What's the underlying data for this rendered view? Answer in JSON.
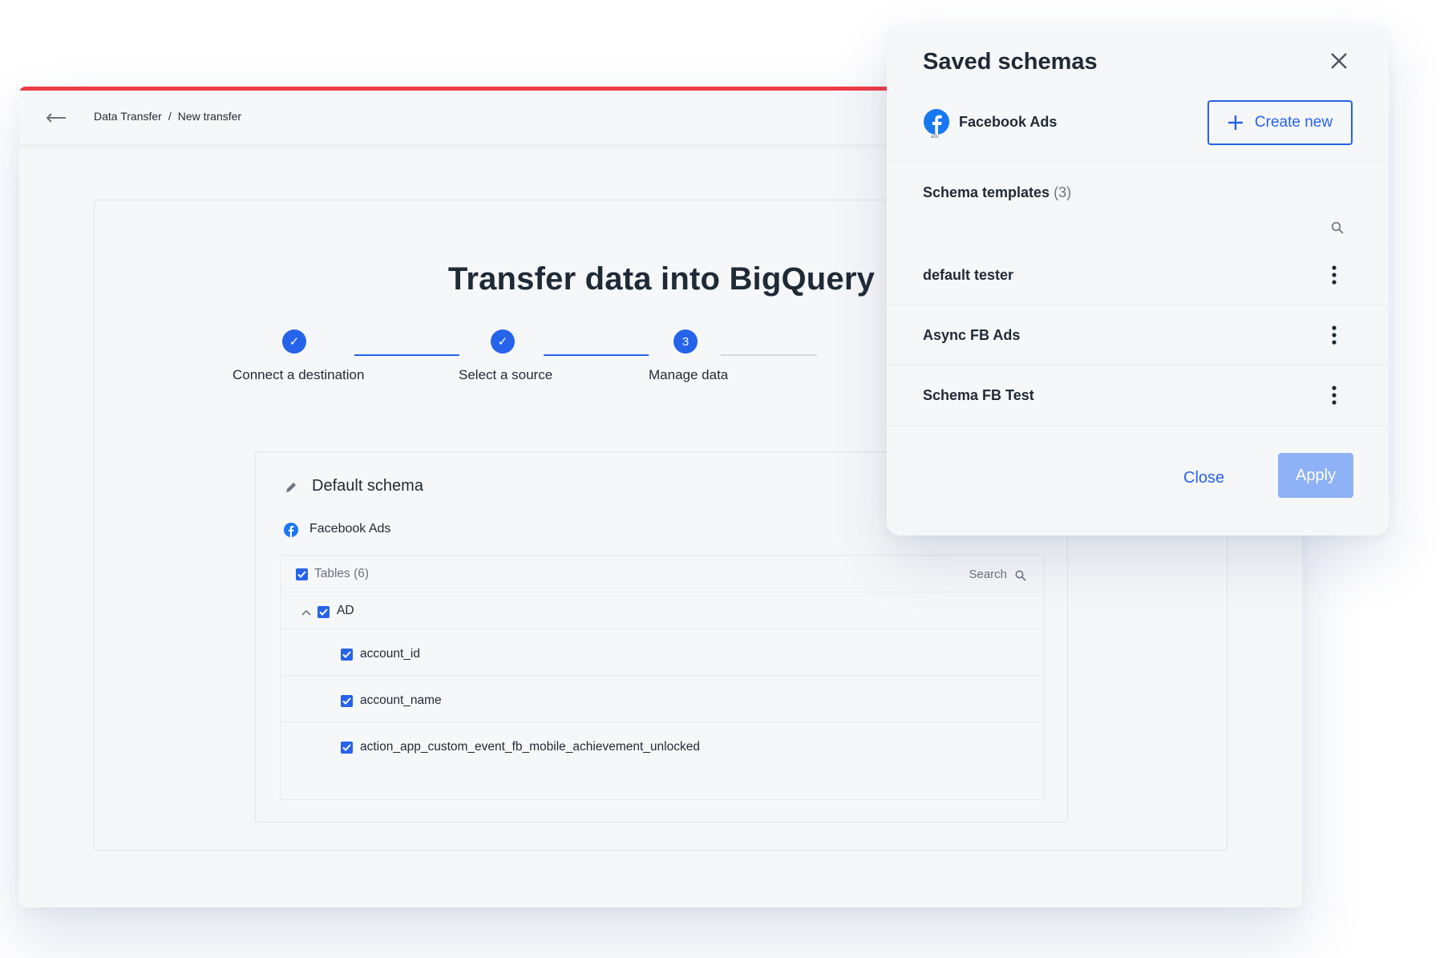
{
  "colors": {
    "accent_bar": "#ef3b46",
    "primary": "#2563eb",
    "apply_disabled": "#8fb1f5",
    "facebook": "#1877f2"
  },
  "breadcrumb": {
    "root": "Data Transfer",
    "separator": "/",
    "current": "New transfer",
    "back_icon": "arrow-left-icon"
  },
  "page": {
    "title": "Transfer data into BigQuery"
  },
  "stepper": {
    "steps": [
      {
        "label": "Connect a destination",
        "state": "done",
        "marker": "✓"
      },
      {
        "label": "Select a source",
        "state": "done",
        "marker": "✓"
      },
      {
        "label": "Manage data",
        "state": "active",
        "marker": "3"
      }
    ]
  },
  "schema": {
    "title": "Default schema",
    "edit_icon": "pencil-icon",
    "source": "Facebook Ads",
    "tables_header": "Tables (6)",
    "search_label": "Search",
    "group": {
      "name": "AD",
      "expanded": true,
      "fields": [
        "account_id",
        "account_name",
        "action_app_custom_event_fb_mobile_achievement_unlocked"
      ]
    }
  },
  "panel": {
    "title": "Saved schemas",
    "close_icon": "close-icon",
    "source": "Facebook Ads",
    "create_label": "Create new",
    "templates_label": "Schema templates",
    "templates_count": "(3)",
    "templates": [
      {
        "name": "default tester"
      },
      {
        "name": "Async FB Ads"
      },
      {
        "name": "Schema FB Test"
      }
    ],
    "close_label": "Close",
    "apply_label": "Apply"
  }
}
